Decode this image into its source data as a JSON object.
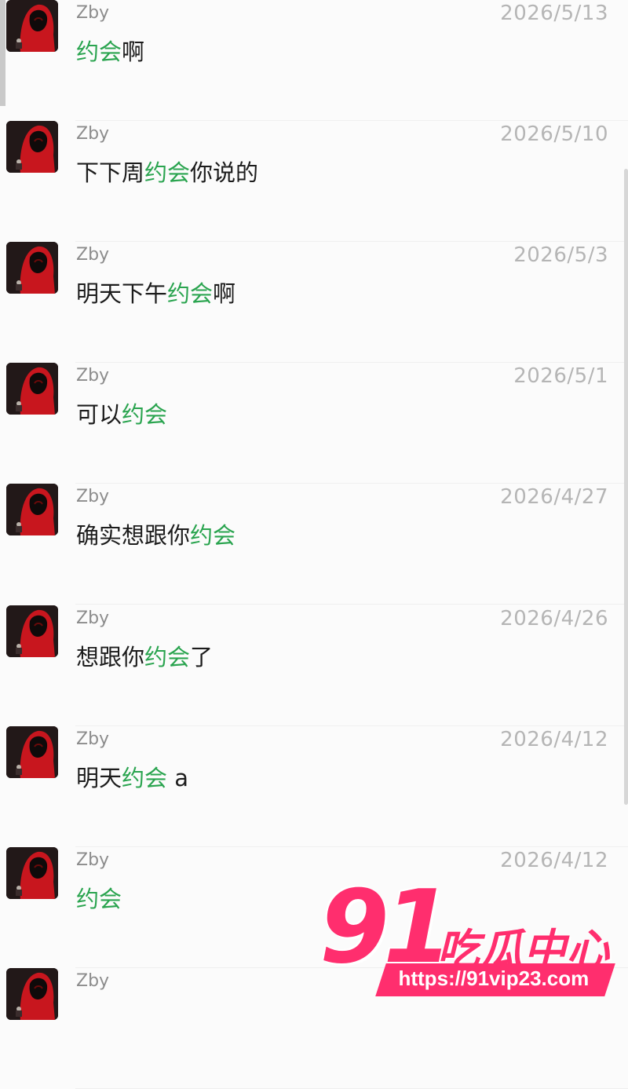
{
  "highlight_color": "#2aa44f",
  "messages": [
    {
      "name": "Zby",
      "date": "2026/5/13",
      "segments": [
        {
          "t": "约会",
          "hl": true
        },
        {
          "t": "啊",
          "hl": false
        }
      ]
    },
    {
      "name": "Zby",
      "date": "2026/5/10",
      "segments": [
        {
          "t": "下下周",
          "hl": false
        },
        {
          "t": "约会",
          "hl": true
        },
        {
          "t": "你说的",
          "hl": false
        }
      ]
    },
    {
      "name": "Zby",
      "date": "2026/5/3",
      "segments": [
        {
          "t": "明天下午",
          "hl": false
        },
        {
          "t": "约会",
          "hl": true
        },
        {
          "t": "啊",
          "hl": false
        }
      ]
    },
    {
      "name": "Zby",
      "date": "2026/5/1",
      "segments": [
        {
          "t": "可以",
          "hl": false
        },
        {
          "t": "约会",
          "hl": true
        }
      ]
    },
    {
      "name": "Zby",
      "date": "2026/4/27",
      "segments": [
        {
          "t": "确实想跟你",
          "hl": false
        },
        {
          "t": "约会",
          "hl": true
        }
      ]
    },
    {
      "name": "Zby",
      "date": "2026/4/26",
      "segments": [
        {
          "t": "想跟你",
          "hl": false
        },
        {
          "t": "约会",
          "hl": true
        },
        {
          "t": "了",
          "hl": false
        }
      ]
    },
    {
      "name": "Zby",
      "date": "2026/4/12",
      "segments": [
        {
          "t": "明天",
          "hl": false
        },
        {
          "t": "约会",
          "hl": true
        },
        {
          "t": " a",
          "hl": false
        }
      ]
    },
    {
      "name": "Zby",
      "date": "2026/4/12",
      "segments": [
        {
          "t": "约会",
          "hl": true
        }
      ]
    },
    {
      "name": "Zby",
      "date": "",
      "segments": []
    }
  ],
  "watermark": {
    "number": "91",
    "text": "吃瓜中心",
    "url": "https://91vip23.com"
  }
}
